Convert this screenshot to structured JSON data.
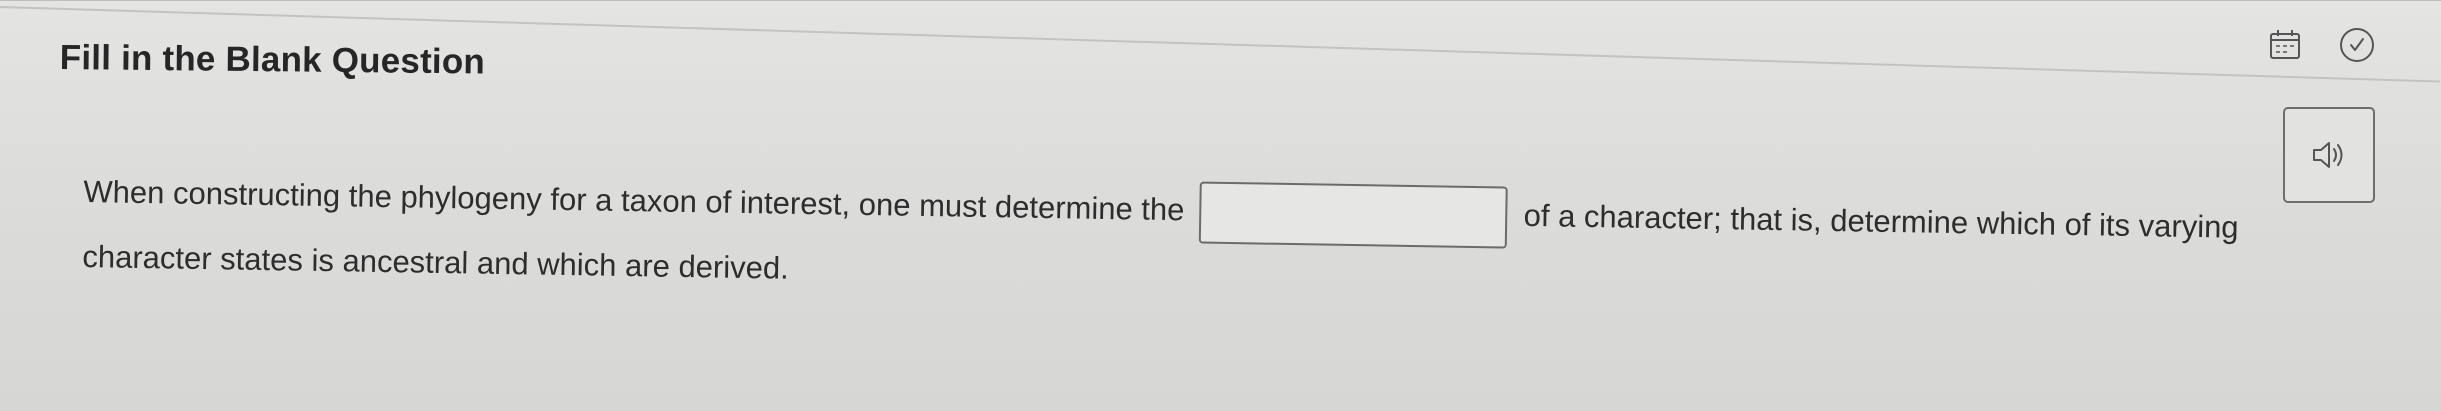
{
  "header": {
    "title": "Fill in the Blank Question"
  },
  "toolbar": {
    "icons": [
      "calendar-icon",
      "check-circle-icon"
    ]
  },
  "audio": {
    "icon": "speaker-icon"
  },
  "question": {
    "text_before": "When constructing the phylogeny for a taxon of interest, one must determine the",
    "blank_value": "",
    "text_after": "of a character; that is, determine which of its varying character states is ancestral and which are derived."
  },
  "colors": {
    "background": "#dcdcda",
    "text": "#2d2d2d",
    "border": "#6b6b6b"
  }
}
